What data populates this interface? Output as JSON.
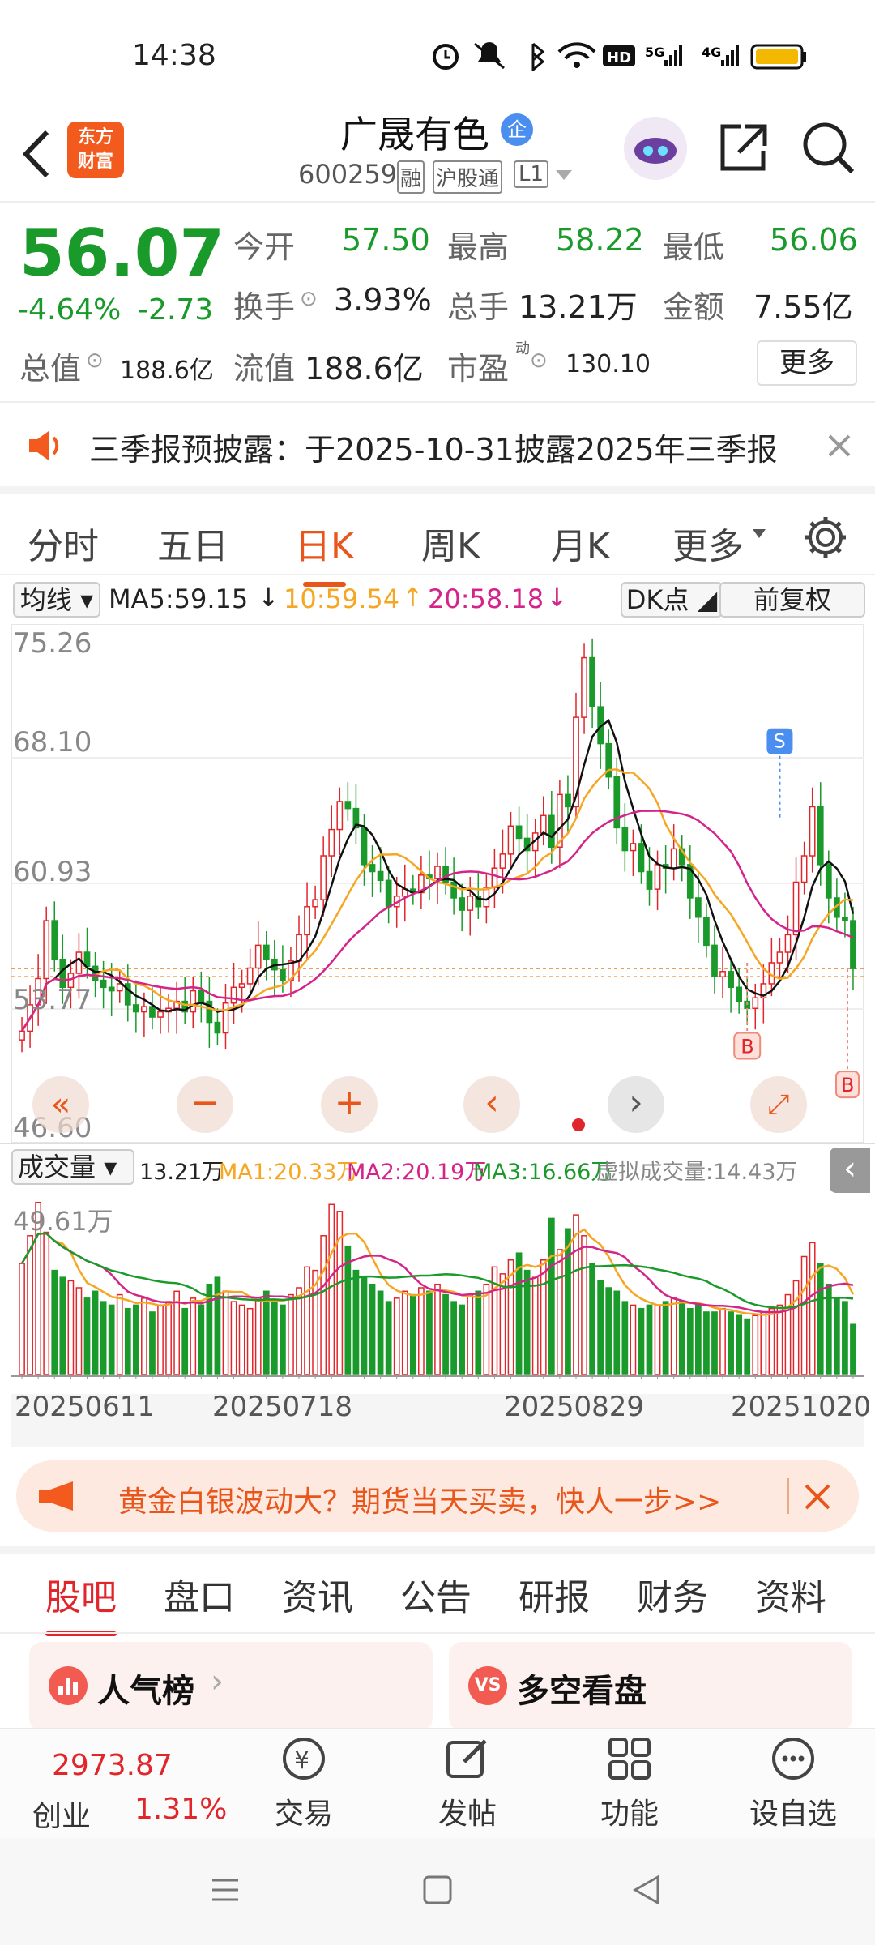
{
  "status": {
    "time": "14:38",
    "signal1": "5G",
    "signal2": "4G",
    "hd": "HD"
  },
  "header": {
    "back_label": "‹",
    "logo_line1": "东方",
    "logo_line2": "财富",
    "stock_name": "广晟有色",
    "badge": "企",
    "code": "600259",
    "tag1": "融",
    "tag2": "沪股通",
    "tag3": "L1"
  },
  "quote": {
    "price": "56.07",
    "change_pct": "-4.64%",
    "change": "-2.73",
    "open_label": "今开",
    "open": "57.50",
    "high_label": "最高",
    "high": "58.22",
    "low_label": "最低",
    "low": "56.06",
    "turnover_label": "换手",
    "turnover": "3.93%",
    "vol_label": "总手",
    "vol": "13.21万",
    "amount_label": "金额",
    "amount": "7.55亿",
    "mcap_label": "总值",
    "mcap": "188.6亿",
    "float_label": "流值",
    "float": "188.6亿",
    "pe_label": "市盈",
    "pe_sup": "动",
    "pe": "130.10",
    "more": "更多"
  },
  "notice": {
    "text": "三季报预披露：于2025-10-31披露2025年三季报"
  },
  "ktabs": {
    "items": [
      "分时",
      "五日",
      "日K",
      "周K",
      "月K",
      "更多"
    ],
    "active": "日K"
  },
  "chart": {
    "ma_button": "均线",
    "ma5": "MA5:59.15",
    "ma10": "10:59.54",
    "ma20": "20:58.18",
    "dk": "DK点",
    "adjust": "前复权",
    "price_ticks": [
      "75.26",
      "68.10",
      "60.93",
      "53.77",
      "46.60"
    ],
    "vol_button": "成交量",
    "vol_val": "13.21万",
    "vol_ma1": "MA1:20.33万",
    "vol_ma2": "MA2:20.19万",
    "vol_ma3": "MA3:16.66万",
    "vol_virtual": "虚拟成交量:14.43万",
    "vol_max": "49.61万",
    "dates": [
      "20250611",
      "20250718",
      "20250829",
      "20251020"
    ],
    "marker_s": "S",
    "marker_b": "B",
    "colors": {
      "up": "#e0252b",
      "down": "#1a9a2a",
      "ma5": "#111111",
      "ma10": "#f5a623",
      "ma20": "#d4248a"
    }
  },
  "chart_data": {
    "type": "candlestick",
    "ylim": [
      46.6,
      75.26
    ],
    "closes": [
      52.5,
      54.0,
      55.5,
      58.8,
      56.6,
      55.0,
      55.8,
      57.0,
      56.2,
      55.4,
      55.0,
      54.8,
      55.2,
      54.0,
      53.6,
      53.9,
      53.3,
      53.6,
      53.8,
      54.2,
      53.6,
      54.8,
      54.2,
      53.0,
      52.4,
      54.1,
      55.0,
      55.2,
      56.1,
      57.4,
      56.6,
      56.0,
      55.4,
      56.5,
      58.0,
      59.6,
      60.0,
      62.5,
      64.0,
      65.6,
      65.2,
      64.1,
      62.0,
      61.6,
      61.1,
      59.6,
      60.2,
      60.6,
      60.4,
      61.4,
      61.2,
      61.9,
      61.0,
      60.1,
      59.4,
      60.2,
      59.6,
      60.7,
      61.8,
      62.6,
      64.2,
      63.5,
      62.8,
      63.8,
      64.8,
      63.0,
      66.0,
      65.3,
      70.4,
      73.8,
      71.0,
      68.9,
      67.0,
      64.1,
      62.8,
      63.2,
      61.6,
      60.6,
      62.0,
      61.8,
      62.9,
      62.0,
      60.1,
      59.0,
      57.4,
      55.6,
      55.9,
      55.0,
      54.2,
      53.8,
      54.4,
      55.2,
      56.4,
      57.0,
      58.0,
      61.0,
      62.5,
      65.3,
      62.0,
      60.1,
      59.0,
      58.8,
      56.07
    ],
    "volumes_wan": [
      32,
      40,
      49.6,
      41,
      30,
      28,
      27,
      25,
      22,
      24,
      21,
      20,
      23,
      19,
      20,
      22,
      18,
      20,
      21,
      24,
      19,
      22,
      20,
      26,
      28,
      24,
      21,
      20,
      19,
      22,
      24,
      21,
      20,
      23,
      25,
      31,
      30,
      40,
      49,
      47,
      37,
      30,
      28,
      26,
      24,
      21,
      22,
      24,
      23,
      25,
      24,
      26,
      23,
      21,
      20,
      23,
      24,
      26,
      31,
      29,
      33,
      35,
      30,
      28,
      33,
      45,
      36,
      42,
      46,
      40,
      32,
      27,
      25,
      24,
      21,
      20,
      19,
      20,
      20,
      21,
      22,
      21,
      19,
      20,
      18,
      18,
      19,
      18,
      17,
      16,
      17,
      18,
      19,
      20,
      23,
      27,
      34,
      38,
      32,
      26,
      22,
      21,
      14.43
    ],
    "ma5": 59.15,
    "ma10": 59.54,
    "ma20": 58.18
  },
  "ad": {
    "text": "黄金白银波动大？期货当天买卖，快人一步>>"
  },
  "nav": {
    "items": [
      "股吧",
      "盘口",
      "资讯",
      "公告",
      "研报",
      "财务",
      "资料"
    ],
    "active": "股吧"
  },
  "cards": {
    "left": "人气榜",
    "right": "多空看盘"
  },
  "bottom": {
    "index_value": "2973.87",
    "index_name": "创业",
    "index_pct": "1.31%",
    "trade": "交易",
    "post": "发帖",
    "func": "功能",
    "watch": "设自选"
  }
}
